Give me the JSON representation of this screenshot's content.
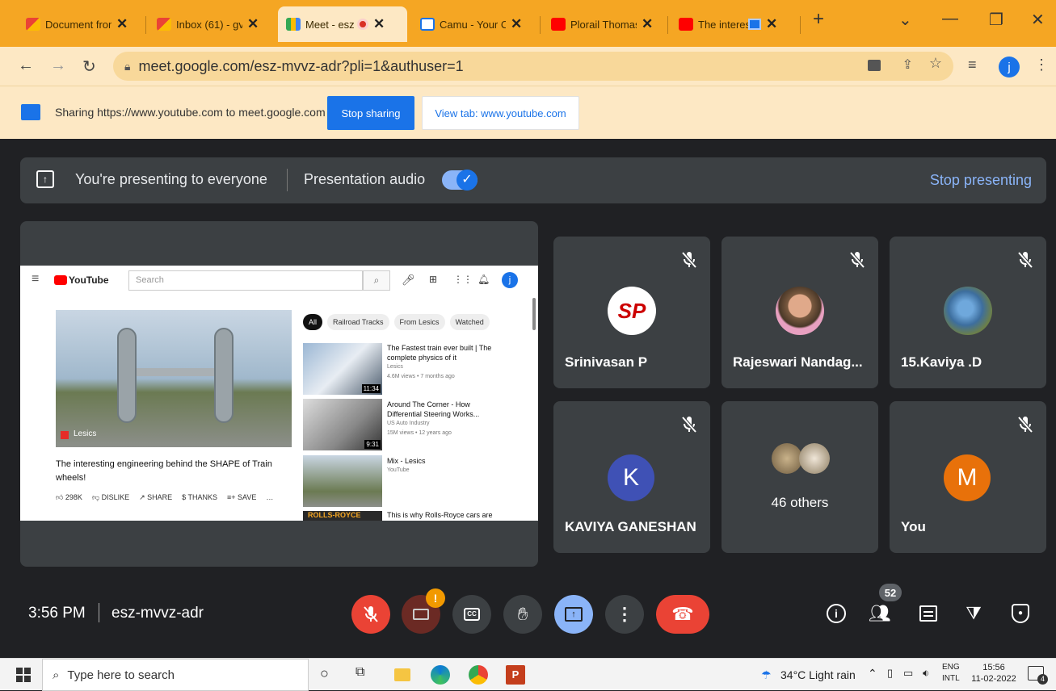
{
  "browser": {
    "tabs": [
      {
        "title": "Document from",
        "favicon": "gmail-icon",
        "color": "#d93025"
      },
      {
        "title": "Inbox (61) - gvc",
        "favicon": "gmail-icon",
        "color": "#d93025"
      },
      {
        "title": "Meet - esz",
        "favicon": "meet-icon",
        "color": "#188038"
      },
      {
        "title": "Camu - Your Co",
        "favicon": "camu-icon",
        "color": "#1a73e8"
      },
      {
        "title": "Plorail Thomas",
        "favicon": "youtube-icon",
        "color": "#ff0000"
      },
      {
        "title": "The interes",
        "favicon": "youtube-icon",
        "color": "#ff0000"
      }
    ],
    "url": "meet.google.com/esz-mvvz-adr?pli=1&authuser=1",
    "profile_initial": "j"
  },
  "sharebar": {
    "text": "Sharing https://www.youtube.com to meet.google.com",
    "stop_label": "Stop sharing",
    "view_label": "View tab: www.youtube.com"
  },
  "presenting": {
    "text": "You're presenting to everyone",
    "audio_label": "Presentation audio",
    "stop_label": "Stop presenting"
  },
  "youtube": {
    "search_placeholder": "Search",
    "logo": "YouTube",
    "chips": [
      "All",
      "Railroad Tracks",
      "From Lesics",
      "Watched"
    ],
    "video_title": "The interesting engineering behind the SHAPE of Train wheels!",
    "channel": "Lesics",
    "actions": [
      "298K",
      "DISLIKE",
      "SHARE",
      "THANKS",
      "SAVE"
    ],
    "recs": [
      {
        "title": "The Fastest train ever built | The complete physics of it",
        "channel": "Lesics",
        "meta": "4.6M views • 7 months ago",
        "duration": "11:34"
      },
      {
        "title": "Around The Corner - How Differential Steering Works...",
        "channel": "US Auto Industry",
        "meta": "15M views • 12 years ago",
        "duration": "9:31"
      },
      {
        "title": "Mix - Lesics",
        "channel": "YouTube",
        "meta": "",
        "duration": ""
      },
      {
        "title": "This is why Rolls-Royce cars are",
        "channel": "",
        "meta": "",
        "duration": ""
      }
    ]
  },
  "participants": [
    {
      "name": "Srinivasan P",
      "type": "logo"
    },
    {
      "name": "Rajeswari Nandag...",
      "type": "photo"
    },
    {
      "name": "15.Kaviya .D",
      "type": "photo"
    },
    {
      "name": "KAVIYA GANESHAN",
      "initial": "K",
      "color": "#3f51b5"
    },
    {
      "name": "46 others",
      "type": "group"
    },
    {
      "name": "You",
      "initial": "M",
      "color": "#e8710a"
    }
  ],
  "meeting": {
    "time": "3:56 PM",
    "code": "esz-mvvz-adr",
    "people_count": "52",
    "alert": "!"
  },
  "taskbar": {
    "search_placeholder": "Type here to search",
    "weather": "34°C  Light rain",
    "lang1": "ENG",
    "lang2": "INTL",
    "time": "15:56",
    "date": "11-02-2022",
    "notif_count": "4"
  }
}
